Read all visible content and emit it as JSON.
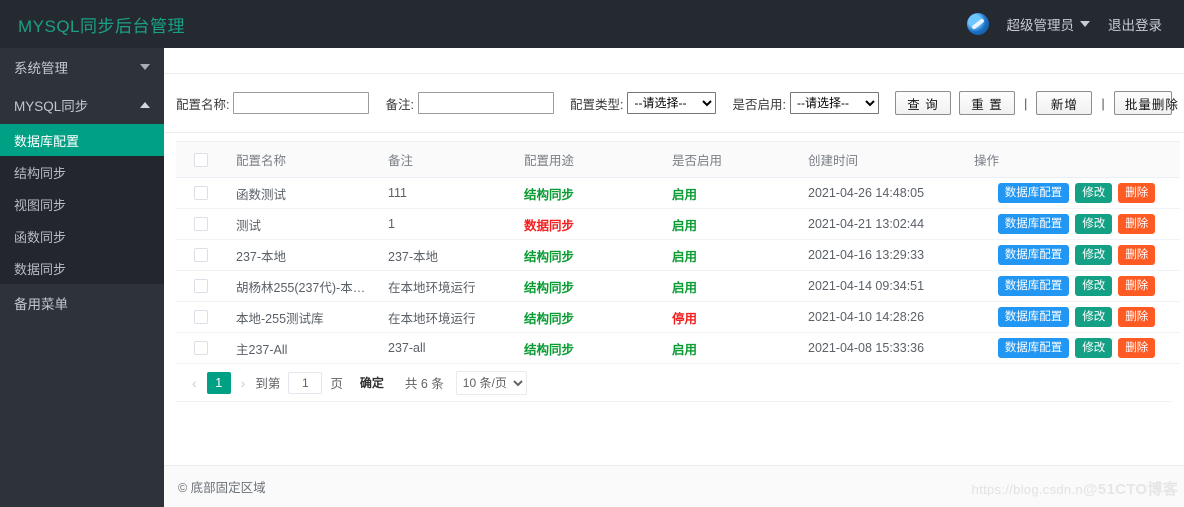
{
  "header": {
    "brand": "MYSQL同步后台管理",
    "avatar_icon": "user-avatar-icon",
    "user_name": "超级管理员",
    "caret_icon": "chevron-down-icon",
    "logout": "退出登录"
  },
  "sidebar": {
    "groups": [
      {
        "label": "系统管理",
        "icon": "chevron-down-icon",
        "expanded": false
      },
      {
        "label": "MYSQL同步",
        "icon": "chevron-up-icon",
        "expanded": true
      }
    ],
    "submenu": [
      {
        "label": "数据库配置",
        "active": true
      },
      {
        "label": "结构同步",
        "active": false
      },
      {
        "label": "视图同步",
        "active": false
      },
      {
        "label": "函数同步",
        "active": false
      },
      {
        "label": "数据同步",
        "active": false
      }
    ],
    "spare": "备用菜单"
  },
  "filter": {
    "name_label": "配置名称:",
    "name_value": "",
    "note_label": "备注:",
    "note_value": "",
    "type_label": "配置类型:",
    "type_value": "--请选择--",
    "enable_label": "是否启用:",
    "enable_value": "--请选择--",
    "select_placeholder": "--请选择--",
    "btn_query": "查 询",
    "btn_reset": "重 置",
    "btn_add": "新增",
    "btn_batch_delete": "批量删除",
    "separator": "|"
  },
  "table": {
    "headers": [
      "",
      "配置名称",
      "备注",
      "配置用途",
      "是否启用",
      "创建时间",
      "操作"
    ],
    "rows": [
      {
        "name": "函数测试",
        "note": "111",
        "use": "结构同步",
        "use_color": "green",
        "enabled": "启用",
        "enabled_color": "green",
        "time": "2021-04-26 14:48:05"
      },
      {
        "name": "测试",
        "note": "1",
        "use": "数据同步",
        "use_color": "red",
        "enabled": "启用",
        "enabled_color": "green",
        "time": "2021-04-21 13:02:44"
      },
      {
        "name": "237-本地",
        "note": "237-本地",
        "use": "结构同步",
        "use_color": "green",
        "enabled": "启用",
        "enabled_color": "green",
        "time": "2021-04-16 13:29:33"
      },
      {
        "name": "胡杨林255(237代)-本…",
        "note": "在本地环境运行",
        "use": "结构同步",
        "use_color": "green",
        "enabled": "启用",
        "enabled_color": "green",
        "time": "2021-04-14 09:34:51"
      },
      {
        "name": "本地-255测试库",
        "note": "在本地环境运行",
        "use": "结构同步",
        "use_color": "green",
        "enabled": "停用",
        "enabled_color": "red",
        "time": "2021-04-10 14:28:26"
      },
      {
        "name": "主237-All",
        "note": "237-all",
        "use": "结构同步",
        "use_color": "green",
        "enabled": "启用",
        "enabled_color": "green",
        "time": "2021-04-08 15:33:36"
      }
    ],
    "actions": {
      "db_config": "数据库配置",
      "edit": "修改",
      "delete": "删除"
    }
  },
  "pagination": {
    "prev_icon": "chevron-left-icon",
    "next_icon": "chevron-right-icon",
    "current_page": "1",
    "goto_label": "到第",
    "goto_value": "1",
    "page_unit": "页",
    "confirm": "确定",
    "total": "共 6 条",
    "page_size": "10 条/页"
  },
  "footer": {
    "text": "© 底部固定区域"
  },
  "watermark": {
    "url": "https://blog.csdn.n",
    "brand": "@51CTO博客"
  },
  "colors": {
    "brand_teal": "#1aa085",
    "active_teal": "#00a085",
    "header_bg": "#252a31",
    "sidebar_bg": "#2e333a",
    "submenu_bg": "#23272d",
    "btn_blue": "#2196f3",
    "btn_teal": "#13a085",
    "btn_orange": "#fd5a24",
    "status_green": "#0a9b33",
    "status_red": "#f41e1e"
  }
}
